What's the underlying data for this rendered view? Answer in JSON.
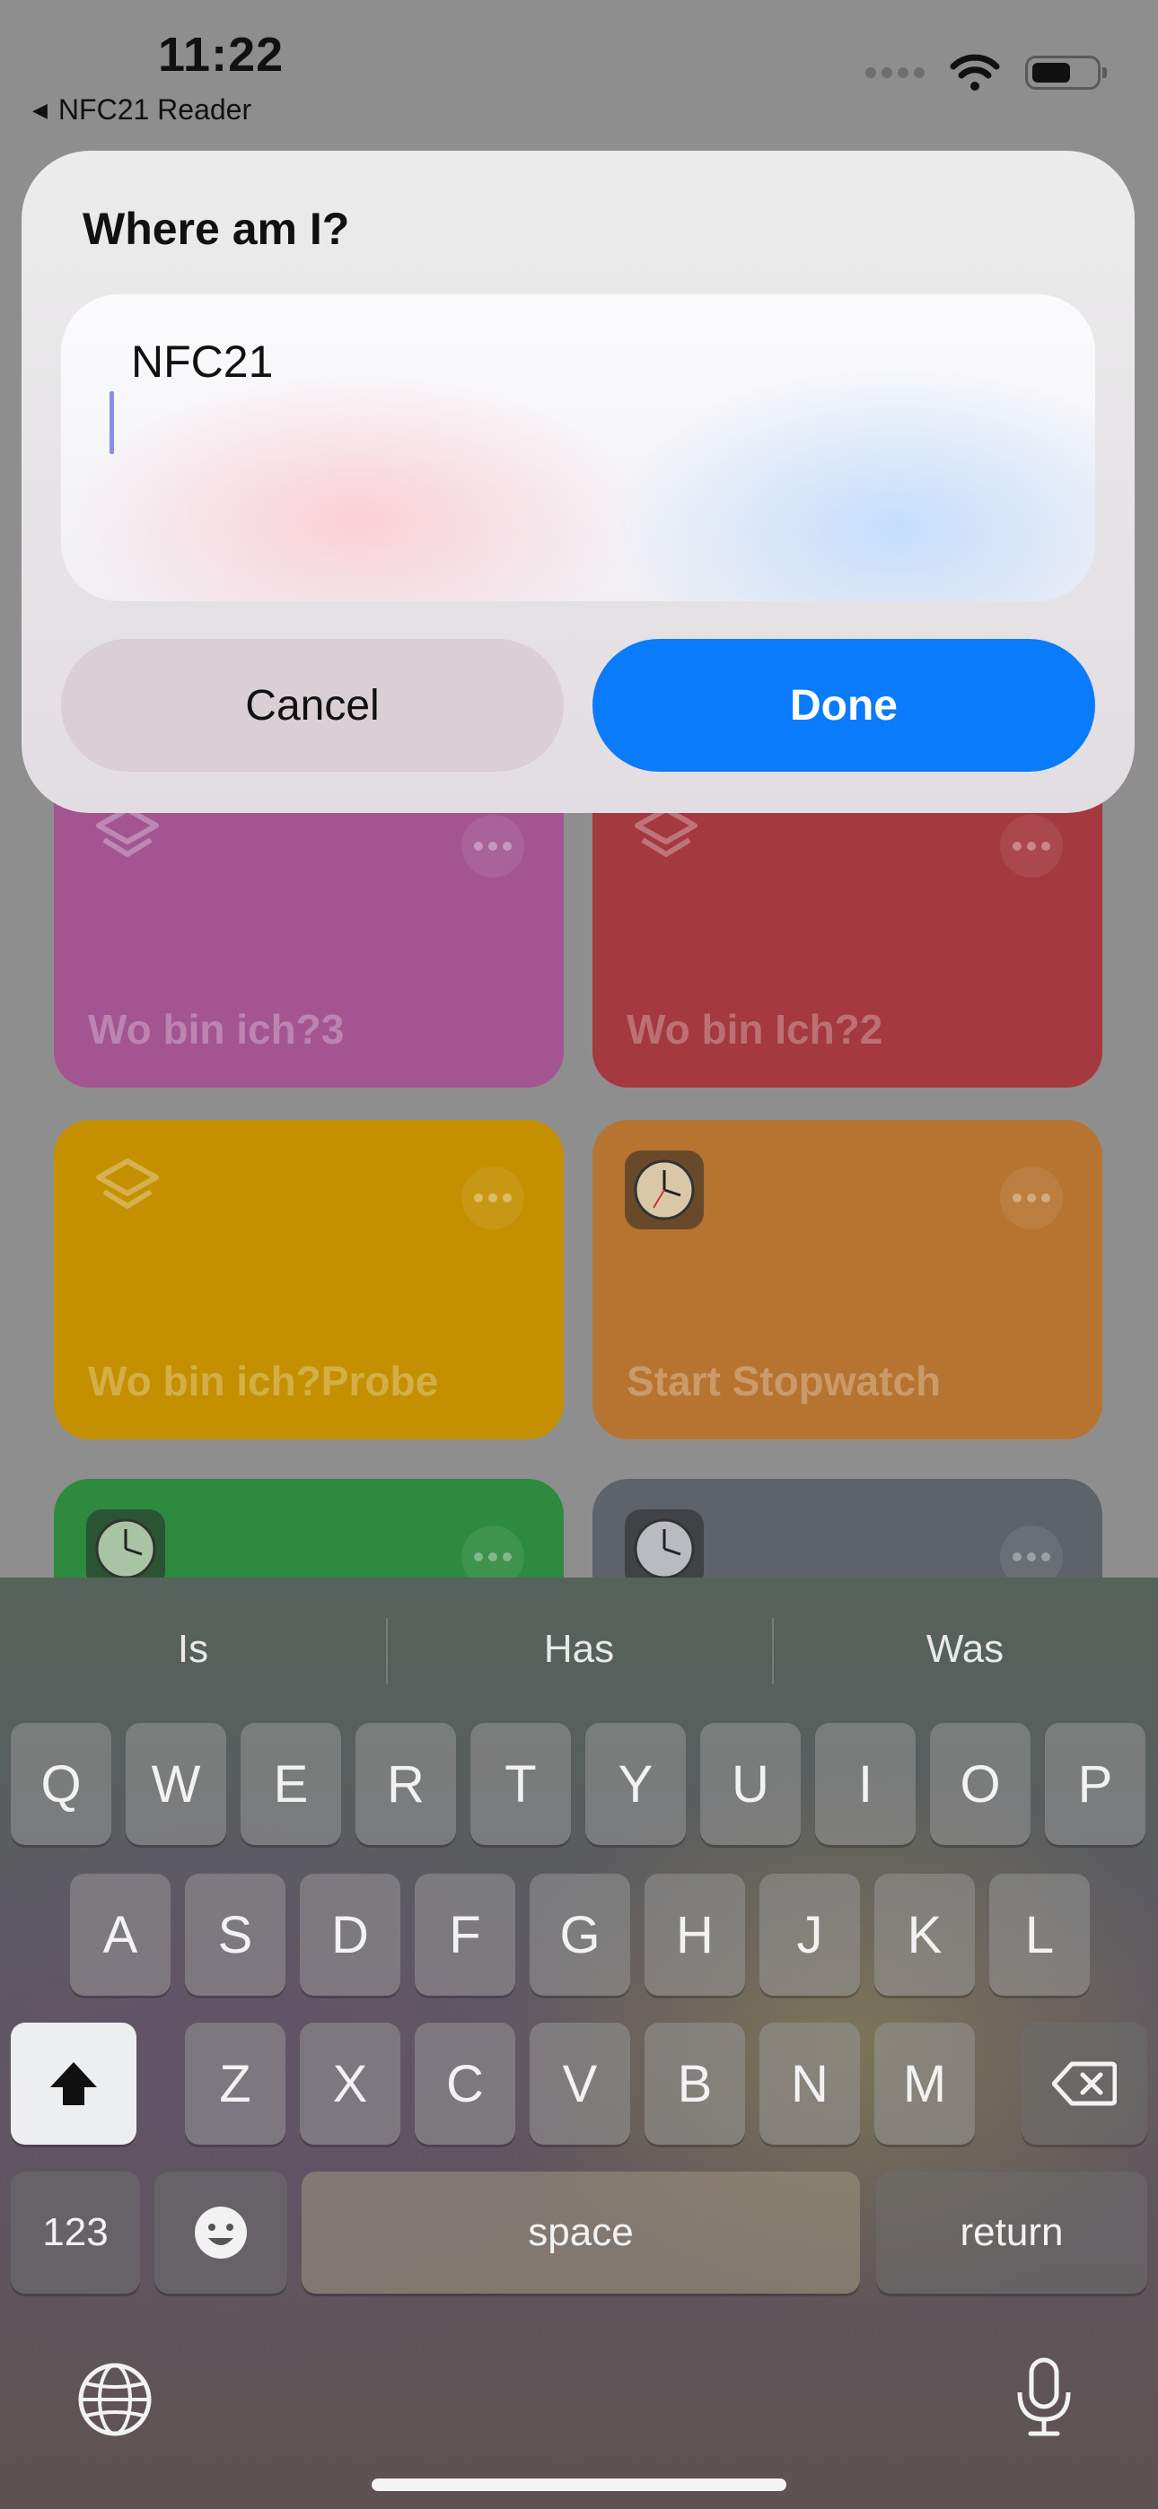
{
  "status_bar": {
    "time": "11:22",
    "back_app_label": "NFC21 Reader"
  },
  "shortcuts": [
    {
      "title": "Wo bin ich?3",
      "color": "#a35592",
      "icon": "layers-icon"
    },
    {
      "title": "Wo bin Ich?2",
      "color": "#a4393f",
      "icon": "layers-icon"
    },
    {
      "title": "Wo bin ich?Probe",
      "color": "#c49000",
      "icon": "layers-icon"
    },
    {
      "title": "Start Stopwatch",
      "color": "#b77330",
      "icon": "clock-icon"
    },
    {
      "title": "",
      "color": "#2e8a3e",
      "icon": "clock-icon"
    },
    {
      "title": "",
      "color": "#5d6369",
      "icon": "clock-icon"
    }
  ],
  "dialog": {
    "title": "Where am I?",
    "field_value": "NFC21",
    "cancel_label": "Cancel",
    "done_label": "Done",
    "accent_color": "#0a7bfa"
  },
  "keyboard": {
    "suggestions": [
      "Is",
      "Has",
      "Was"
    ],
    "row1": [
      "Q",
      "W",
      "E",
      "R",
      "T",
      "Y",
      "U",
      "I",
      "O",
      "P"
    ],
    "row2": [
      "A",
      "S",
      "D",
      "F",
      "G",
      "H",
      "J",
      "K",
      "L"
    ],
    "row3": [
      "Z",
      "X",
      "C",
      "V",
      "B",
      "N",
      "M"
    ],
    "numbers_label": "123",
    "space_label": "space",
    "return_label": "return"
  }
}
